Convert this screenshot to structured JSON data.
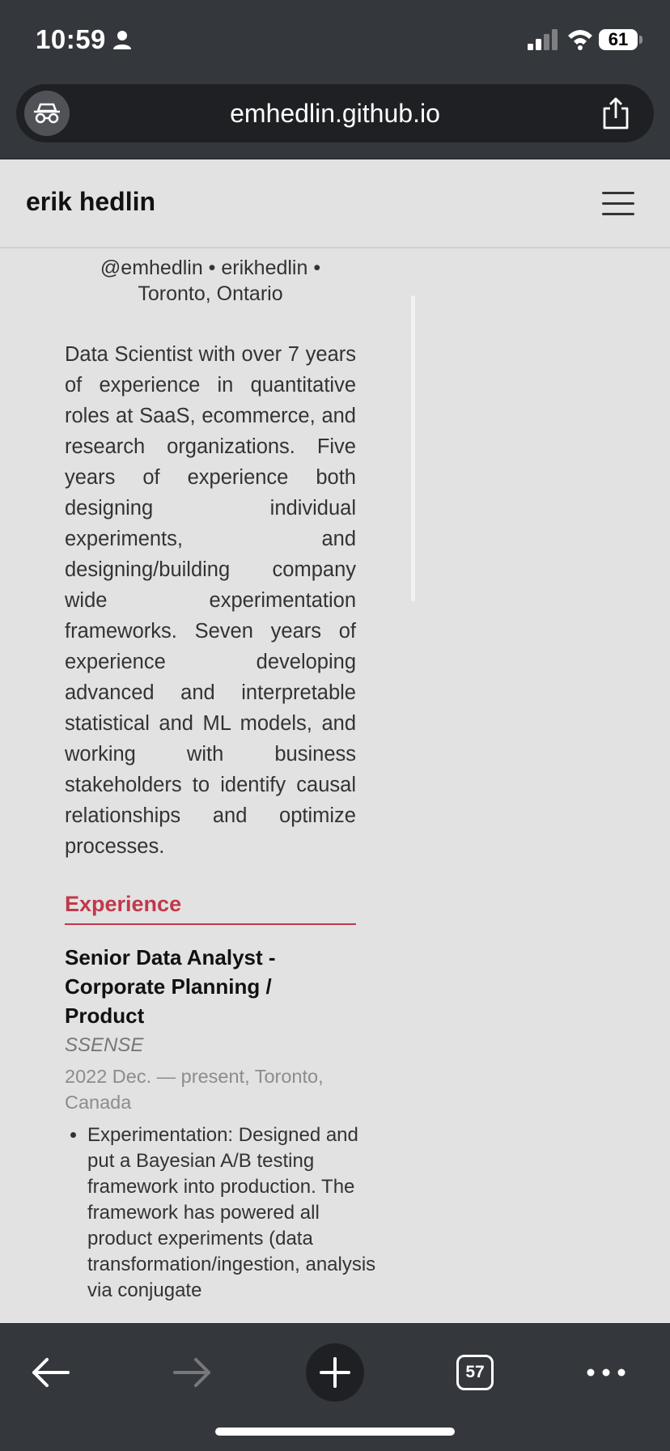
{
  "status_bar": {
    "time": "10:59",
    "battery": "61",
    "icons": [
      "person-icon",
      "signal-icon",
      "wifi-icon",
      "battery-icon"
    ]
  },
  "browser": {
    "url": "emhedlin.github.io",
    "left_icon": "incognito-icon",
    "right_icon": "share-icon"
  },
  "site": {
    "title": "erik hedlin",
    "menu_icon": "hamburger-menu-icon"
  },
  "profile": {
    "contact_line_1": "@emhedlin • erikhedlin •",
    "contact_line_2": "Toronto, Ontario",
    "bio": "Data Scientist with over 7 years of experience in quantitative roles at SaaS, ecommerce, and research organizations. Five years of experience both designing individual experiments, and designing/building company wide experimentation frameworks. Seven years of experience developing advanced and interpretable statistical and ML models, and working with business stakeholders to identify causal relationships and optimize processes."
  },
  "experience": {
    "heading": "Experience",
    "jobs": [
      {
        "title": "Senior Data Analyst - Corporate Planning / Product",
        "company": "SSENSE",
        "dates": "2022 Dec. — present, Toronto, Canada",
        "bullets": [
          "Experimentation: Designed and put a Bayesian A/B testing framework into production. The framework has powered all product experiments (data transformation/ingestion, analysis via conjugate"
        ]
      }
    ]
  },
  "toolbar": {
    "tab_count": "57",
    "icons": [
      "back-arrow-icon",
      "forward-arrow-icon",
      "plus-icon",
      "tabs-icon",
      "more-icon"
    ]
  }
}
